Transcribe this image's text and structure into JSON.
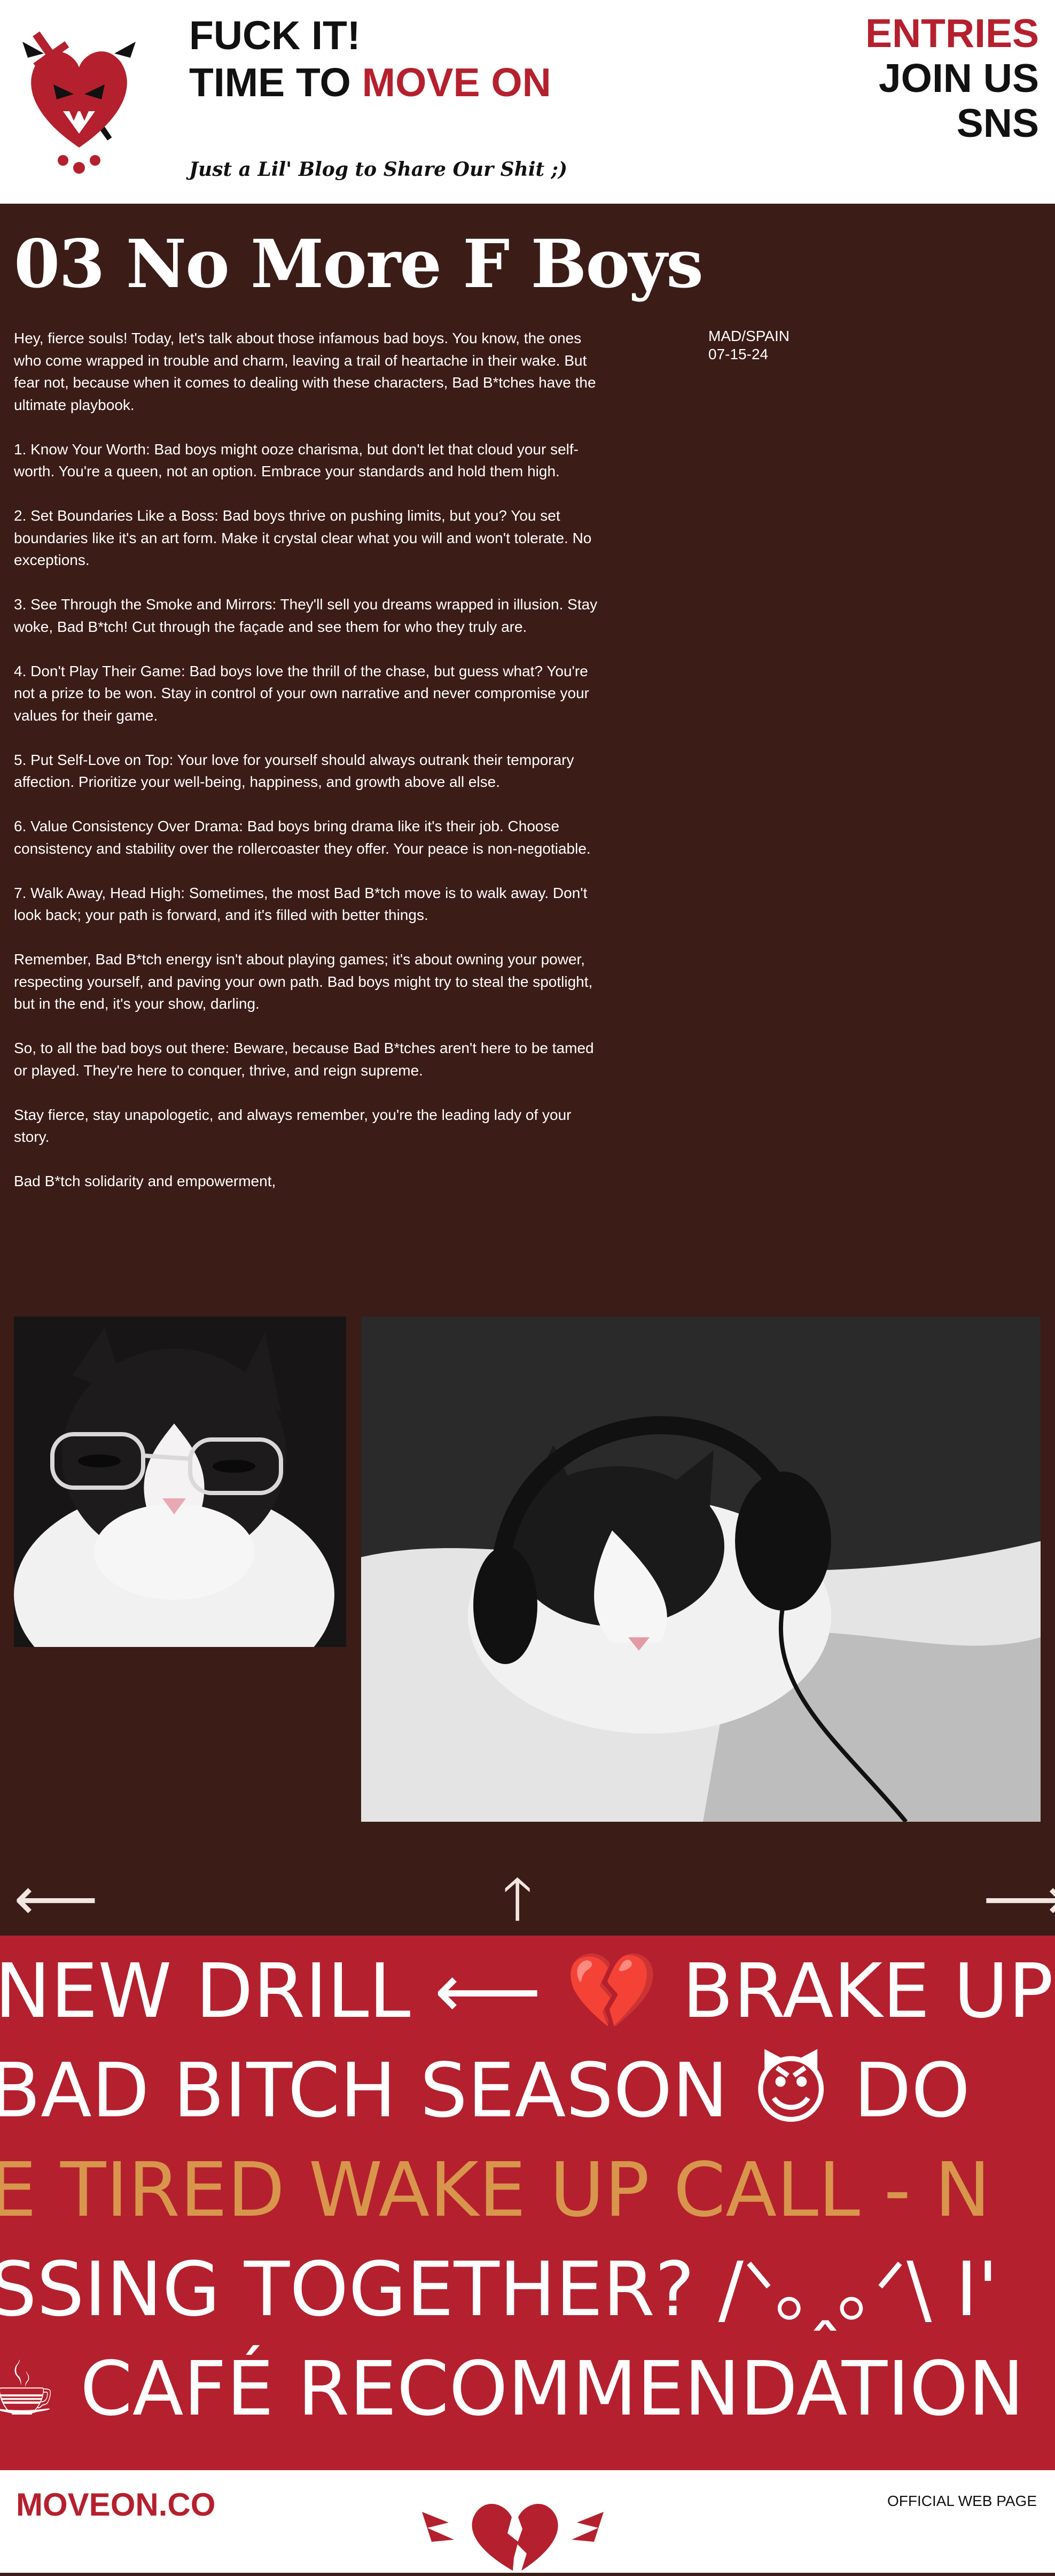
{
  "header": {
    "title_line1": "FUCK IT!",
    "title_line2_prefix": "TIME TO ",
    "title_line2_accent": "MOVE ON",
    "tagline": "Just a Lil' Blog to Share Our Shit ;)",
    "logo_icon": "dagger-heart-icon"
  },
  "nav": {
    "entries": "ENTRIES",
    "join": "JOIN US",
    "sns": "SNS"
  },
  "post": {
    "title": "03 No More F Boys",
    "location": "MAD/SPAIN",
    "date": "07-15-24",
    "paragraphs": [
      "Hey, fierce souls! Today, let's talk about those infamous bad boys. You know, the ones who come wrapped in trouble and charm, leaving a trail of heartache in their wake. But fear not, because when it comes to dealing with these characters, Bad B*tches have the ultimate playbook.",
      "1. Know Your Worth: Bad boys might ooze charisma, but don't let that cloud your self-worth. You're a queen, not an option. Embrace your standards and hold them high.",
      "2. Set Boundaries Like a Boss: Bad boys thrive on pushing limits, but you? You set boundaries like it's an art form. Make it crystal clear what you will and won't tolerate. No exceptions.",
      "3. See Through the Smoke and Mirrors: They'll sell you dreams wrapped in illusion. Stay woke, Bad B*tch! Cut through the façade and see them for who they truly are.",
      "4. Don't Play Their Game: Bad boys love the thrill of the chase, but guess what? You're not a prize to be won. Stay in control of your own narrative and never compromise your values for their game.",
      "5. Put Self-Love on Top: Your love for yourself should always outrank their temporary affection. Prioritize your well-being, happiness, and growth above all else.",
      "6. Value Consistency Over Drama: Bad boys bring drama like it's their job. Choose consistency and stability over the rollercoaster they offer. Your peace is non-negotiable.",
      "7. Walk Away, Head High: Sometimes, the most Bad B*tch move is to walk away. Don't look back; your path is forward, and it's filled with better things.",
      "Remember, Bad B*tch energy isn't about playing games; it's about owning your power, respecting yourself, and paving your own path. Bad boys might try to steal the spotlight, but in the end, it's your show, darling.",
      "So, to all the bad boys out there: Beware, because Bad B*tches aren't here to be tamed or played. They're here to conquer, thrive, and reign supreme.",
      "Stay fierce, stay unapologetic, and always remember, you're the leading lady of your story.",
      "Bad B*tch solidarity and empowerment,"
    ]
  },
  "photos": {
    "photo1_icon": "cat-with-glasses-photo",
    "photo2_icon": "cat-with-headphones-photo"
  },
  "arrows": {
    "prev": "⟵",
    "top": "🡑",
    "next": "⟶"
  },
  "tickers": [
    "NEW DRILL ⟵ 💔 BRAKE UP",
    "BAD BITCH SEASON 😈 DO",
    "E TIRED   WAKE UP CALL - N",
    "SSING TOGETHER? /ᐠ｡ꞈ｡ᐟ\\ I'",
    "☕ CAFÉ RECOMMENDATION"
  ],
  "footer": {
    "brand": "MOVEON.CO",
    "official": "OFFICIAL WEB PAGE",
    "logo_icon": "broken-heart-logo-icon"
  },
  "colors": {
    "accent": "#b5202e",
    "background": "#3b1c17",
    "gold": "#d8964c",
    "text_light": "#ffffff"
  }
}
